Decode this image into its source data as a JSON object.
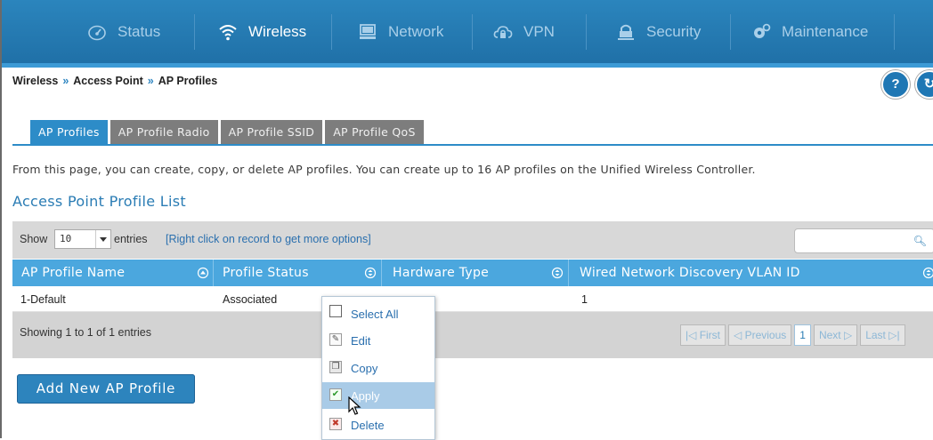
{
  "nav": {
    "items": [
      {
        "label": "Status",
        "icon": "gauge-icon",
        "active": false
      },
      {
        "label": "Wireless",
        "icon": "wifi-icon",
        "active": true
      },
      {
        "label": "Network",
        "icon": "monitor-icon",
        "active": false
      },
      {
        "label": "VPN",
        "icon": "cloud-lock-icon",
        "active": false
      },
      {
        "label": "Security",
        "icon": "lock-icon",
        "active": false
      },
      {
        "label": "Maintenance",
        "icon": "gears-icon",
        "active": false
      }
    ]
  },
  "breadcrumb": {
    "items": [
      "Wireless",
      "Access Point",
      "AP Profiles"
    ],
    "separator": "»"
  },
  "help": {
    "help_label": "?",
    "refresh_label": "↻"
  },
  "tabs": [
    "AP Profiles",
    "AP Profile Radio",
    "AP Profile SSID",
    "AP Profile QoS"
  ],
  "description": "From this page, you can create, copy, or delete AP profiles. You can create up to 16 AP profiles on the Unified Wireless Controller.",
  "section_title": "Access Point Profile List",
  "toolbar": {
    "show_label": "Show",
    "page_size": "10",
    "entries_label": "entries",
    "hint": "[Right click on record to get more options]"
  },
  "table": {
    "columns": [
      "AP Profile Name",
      "Profile Status",
      "Hardware Type",
      "Wired Network Discovery VLAN ID"
    ],
    "rows": [
      [
        "1-Default",
        "Associated",
        "",
        "1"
      ]
    ]
  },
  "footer": {
    "info": "Showing 1 to 1 of 1 entries",
    "pager": {
      "first": "First",
      "previous": "Previous",
      "current": "1",
      "next": "Next",
      "last": "Last"
    }
  },
  "add_button": "Add New AP Profile",
  "context_menu": {
    "items": [
      {
        "label": "Select All",
        "icon": "checkbox-icon",
        "highlighted": false
      },
      {
        "label": "Edit",
        "icon": "pencil-icon",
        "highlighted": false
      },
      {
        "label": "Copy",
        "icon": "copy-icon",
        "highlighted": false
      },
      {
        "label": "Apply",
        "icon": "check-icon",
        "highlighted": true
      },
      {
        "label": "Delete",
        "icon": "delete-x-icon",
        "highlighted": false
      }
    ]
  },
  "colors": {
    "nav_bg": "#1f6fa6",
    "accent": "#2d8cc8",
    "header_bg": "#4ba7de",
    "tab_inactive": "#7d7d7d"
  }
}
